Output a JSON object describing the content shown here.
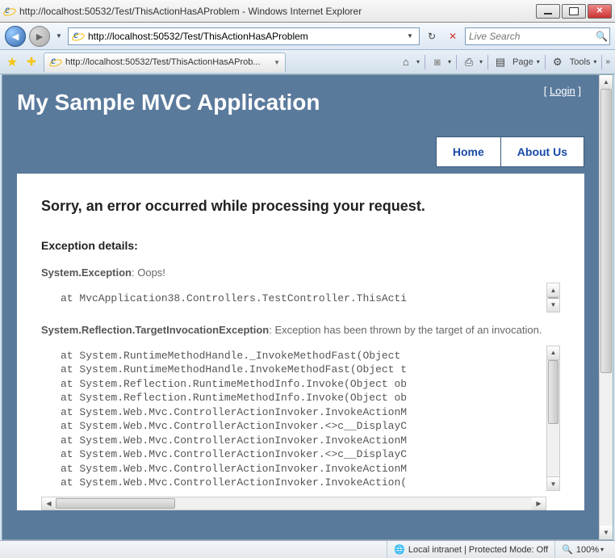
{
  "window": {
    "title": "http://localhost:50532/Test/ThisActionHasAProblem - Windows Internet Explorer"
  },
  "address": {
    "url": "http://localhost:50532/Test/ThisActionHasAProblem"
  },
  "search": {
    "placeholder": "Live Search"
  },
  "tab": {
    "title": "http://localhost:50532/Test/ThisActionHasAProb..."
  },
  "toolbar": {
    "page": "Page",
    "tools": "Tools"
  },
  "app": {
    "title": "My Sample MVC Application",
    "login_prefix": "[ ",
    "login_link": "Login",
    "login_suffix": " ]",
    "nav_home": "Home",
    "nav_about": "About Us"
  },
  "error": {
    "heading": "Sorry, an error occurred while processing your request.",
    "details_label": "Exception details:",
    "ex1_type": "System.Exception",
    "ex1_msg": ": Oops!",
    "ex1_stack": "at MvcApplication38.Controllers.TestController.ThisActi",
    "ex2_type": "System.Reflection.TargetInvocationException",
    "ex2_msg": ": Exception has been thrown by the target of an invocation.",
    "ex2_stack": "at System.RuntimeMethodHandle._InvokeMethodFast(Object \nat System.RuntimeMethodHandle.InvokeMethodFast(Object t\nat System.Reflection.RuntimeMethodInfo.Invoke(Object ob\nat System.Reflection.RuntimeMethodInfo.Invoke(Object ob\nat System.Web.Mvc.ControllerActionInvoker.InvokeActionM\nat System.Web.Mvc.ControllerActionInvoker.<>c__DisplayC\nat System.Web.Mvc.ControllerActionInvoker.InvokeActionM\nat System.Web.Mvc.ControllerActionInvoker.<>c__DisplayC\nat System.Web.Mvc.ControllerActionInvoker.InvokeActionM\nat System.Web.Mvc.ControllerActionInvoker.InvokeAction("
  },
  "status": {
    "zone": "Local intranet | Protected Mode: Off",
    "zoom": "100%"
  }
}
